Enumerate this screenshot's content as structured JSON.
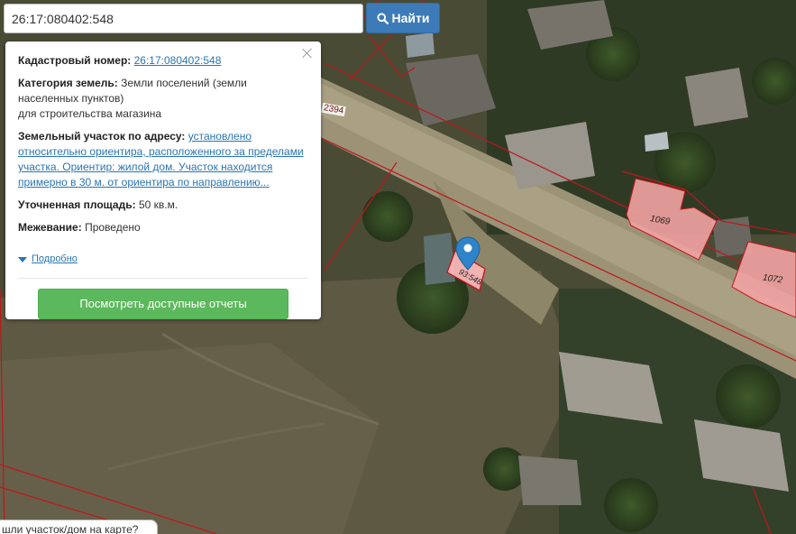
{
  "search": {
    "value": "26:17:080402:548",
    "button_label": "Найти",
    "button_icon": "search-icon"
  },
  "popup": {
    "cadastral_label": "Кадастровый номер:",
    "cadastral_value": "26:17:080402:548",
    "category_label": "Категория земель:",
    "category_value_line1": "Земли поселений (земли",
    "category_value_line2": "населенных пунктов)",
    "category_value_line3": "для строительства магазина",
    "address_label": "Земельный участок по адресу:",
    "address_value_line1": "установлено",
    "address_value_line2": "относительно ориентира, расположенного за пределами",
    "address_value_line3": "участка. Ориентир: жилой дом. Участок находится",
    "address_value_line4": "примерно в 30 м. от ориентира по направлению...",
    "area_label": "Уточненная площадь:",
    "area_value": "50 кв.м.",
    "survey_label": "Межевание:",
    "survey_value": "Проведено",
    "more_label": "Подробно",
    "reports_button": "Посмотреть доступные отчеты",
    "close_icon": "close-icon"
  },
  "map": {
    "parcel_labels": [
      "1069",
      "1072",
      "2394"
    ],
    "selected_parcel_label": "93:548",
    "marker_icon": "map-pin-icon",
    "boundary_color": "#c0161b",
    "parcel_fill_color": "#f2a3a3"
  },
  "bottom_hint": "шли участок/дом на карте?",
  "colors": {
    "search_button": "#3d7ab8",
    "reports_button": "#5cb85c",
    "link": "#2a75b3"
  }
}
